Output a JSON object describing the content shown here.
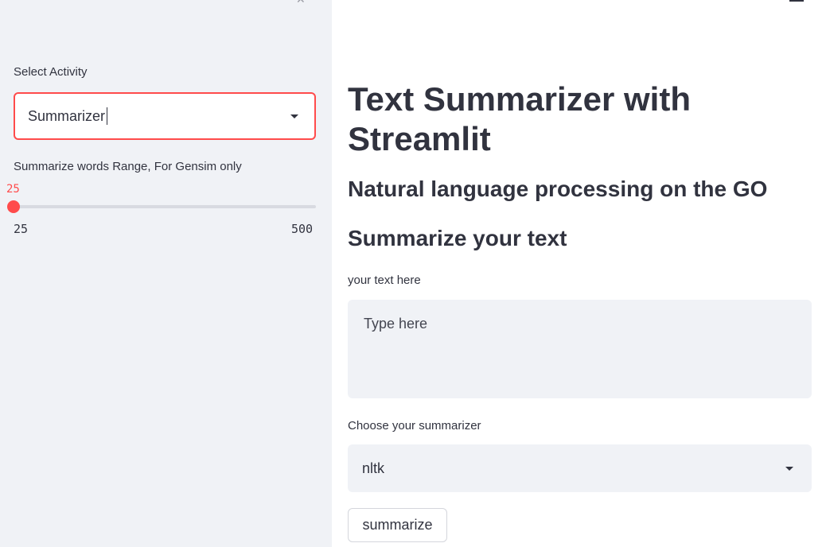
{
  "sidebar": {
    "activity_label": "Select Activity",
    "activity_value": "Summarizer",
    "range_label": "Summarize words Range, For Gensim only",
    "range_value": "25",
    "range_min": "25",
    "range_max": "500",
    "range_fraction": 0.0
  },
  "main": {
    "title": "Text Summarizer with Streamlit",
    "subtitle": "Natural language processing on the GO",
    "section_heading": "Summarize your text",
    "text_label": "your text here",
    "text_placeholder": "Type here",
    "summarizer_label": "Choose your summarizer",
    "summarizer_value": "nltk",
    "submit_label": "summarize"
  },
  "colors": {
    "accent": "#ff4b4b",
    "sidebar_bg": "#f0f2f6",
    "text": "#31333f"
  },
  "icons": {
    "dropdown": "chevron-down-icon",
    "sidebar_toggle": "close-icon",
    "menu": "hamburger-menu-icon"
  }
}
